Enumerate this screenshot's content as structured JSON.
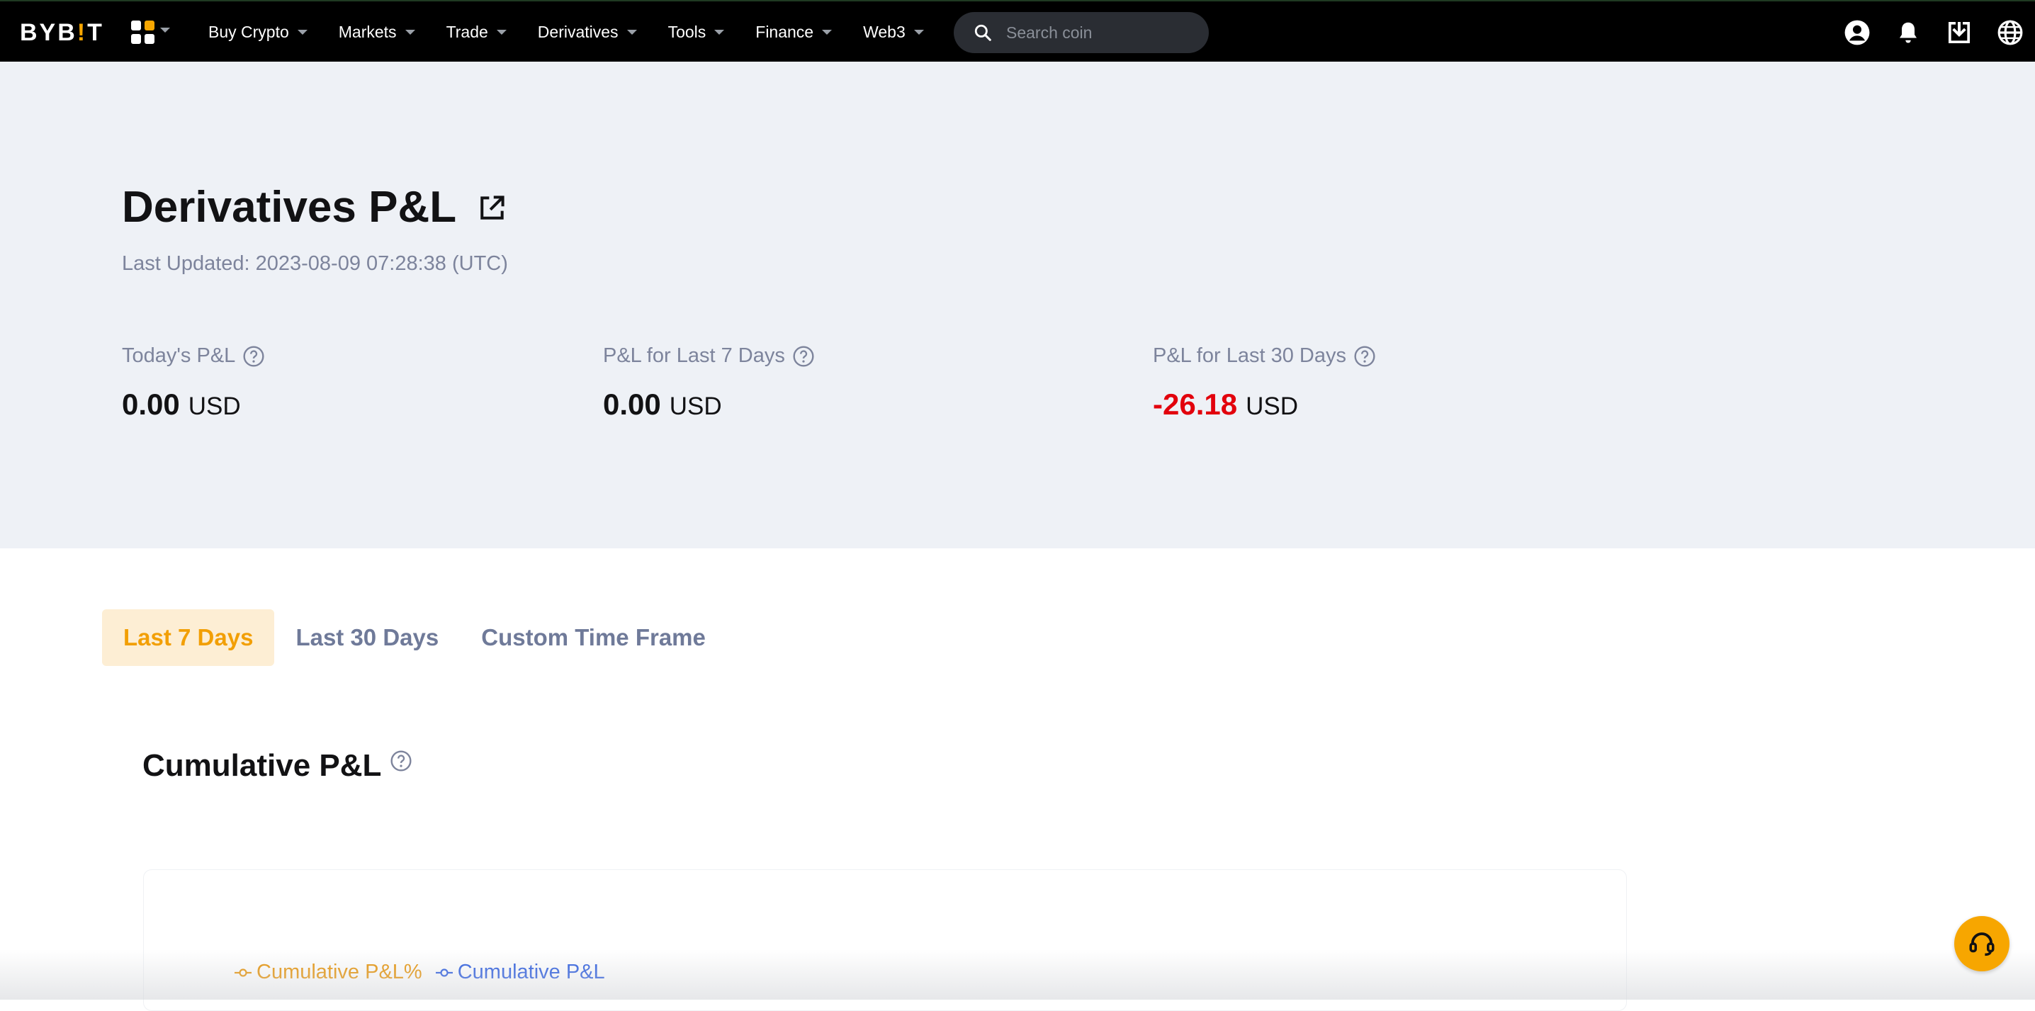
{
  "brand": {
    "logo_text_a": "BYB",
    "logo_text_i": "!",
    "logo_text_b": "T",
    "accent": "#f7a600"
  },
  "nav": {
    "items": [
      {
        "label": "Buy Crypto"
      },
      {
        "label": "Markets"
      },
      {
        "label": "Trade"
      },
      {
        "label": "Derivatives"
      },
      {
        "label": "Tools"
      },
      {
        "label": "Finance"
      },
      {
        "label": "Web3"
      }
    ],
    "search_placeholder": "Search coin",
    "icons": [
      "user-icon",
      "bell-icon",
      "download-icon",
      "globe-icon"
    ]
  },
  "page": {
    "title": "Derivatives P&L",
    "last_updated": "Last Updated: 2023-08-09 07:28:38 (UTC)"
  },
  "stats": [
    {
      "label": "Today's P&L",
      "value": "0.00",
      "unit": "USD"
    },
    {
      "label": "P&L for Last 7 Days",
      "value": "0.00",
      "unit": "USD"
    },
    {
      "label": "P&L for Last 30 Days",
      "value": "-26.18",
      "unit": "USD",
      "color": "#e2000c"
    }
  ],
  "tabs": [
    {
      "label": "Last 7 Days",
      "active": true
    },
    {
      "label": "Last 30 Days",
      "active": false
    },
    {
      "label": "Custom Time Frame",
      "active": false
    }
  ],
  "section": {
    "title": "Cumulative P&L",
    "legend": [
      {
        "label": "Cumulative P&L%",
        "color": "#e8950b"
      },
      {
        "label": "Cumulative P&L",
        "color": "#2f5fe0"
      }
    ]
  }
}
